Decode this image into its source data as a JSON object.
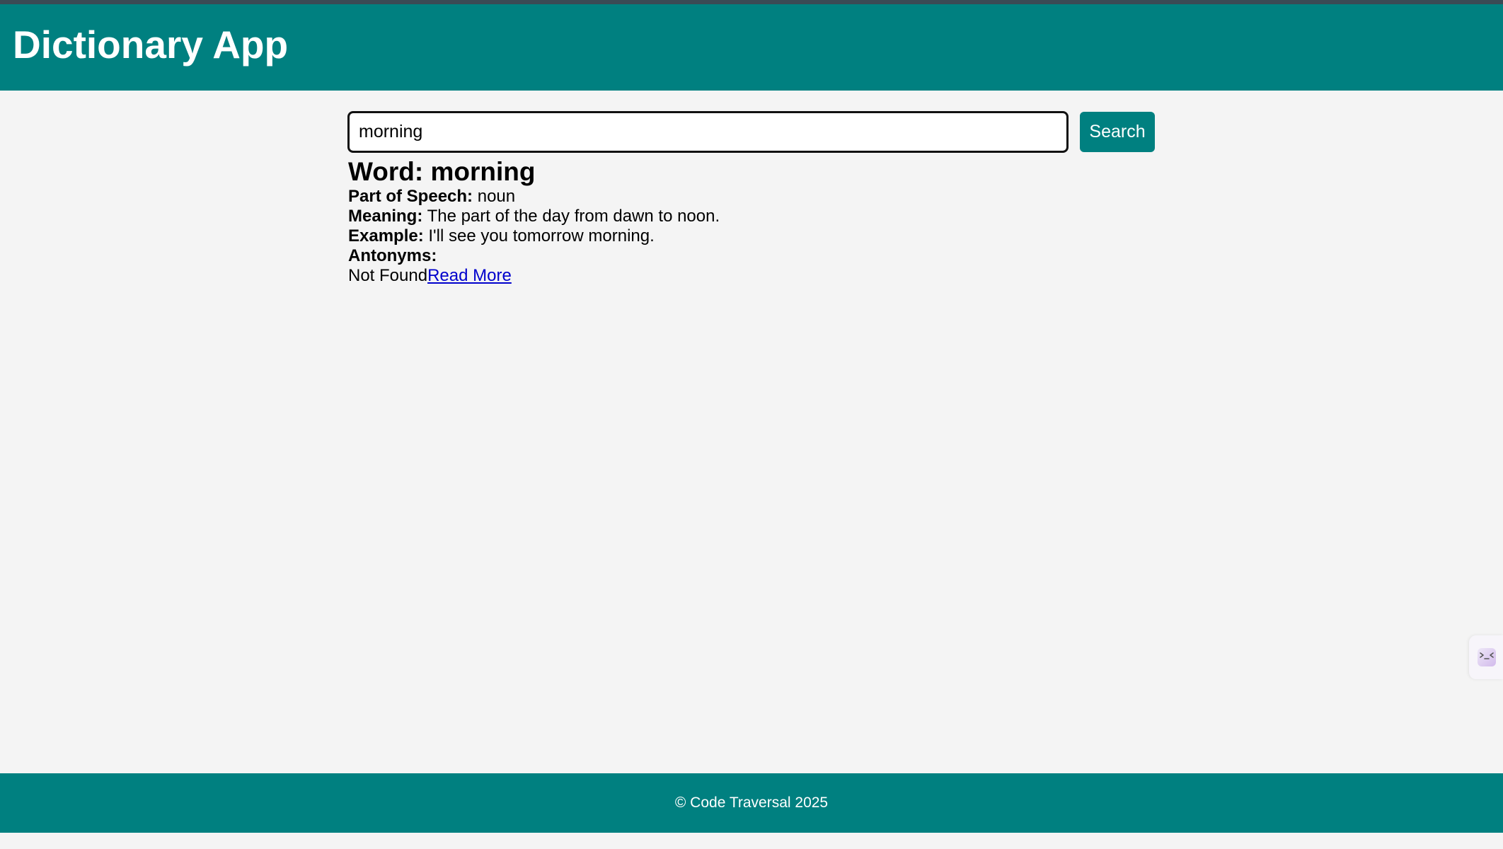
{
  "header": {
    "title": "Dictionary App"
  },
  "search": {
    "value": "morning",
    "button_label": "Search"
  },
  "result": {
    "word_label": "Word:",
    "word": "morning",
    "part_of_speech_label": "Part of Speech:",
    "part_of_speech": "noun",
    "meaning_label": "Meaning:",
    "meaning": "The part of the day from dawn to noon.",
    "example_label": "Example:",
    "example": "I'll see you tomorrow morning.",
    "antonyms_label": "Antonyms:",
    "antonyms": "Not Found",
    "read_more_label": "Read More"
  },
  "footer": {
    "text": "© Code Traversal 2025"
  },
  "colors": {
    "brand": "#008080",
    "background": "#f4f4f4",
    "link": "#0000cc"
  },
  "icons": {
    "side_widget": "assistant-face-icon"
  }
}
